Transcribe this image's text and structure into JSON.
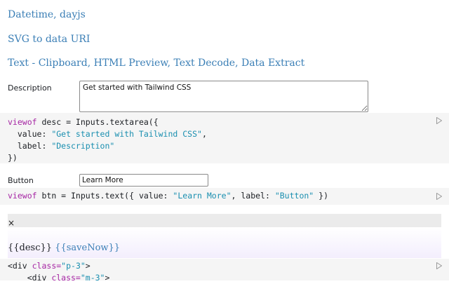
{
  "links": [
    {
      "label": "Datetime, dayjs"
    },
    {
      "label": "SVG to data URI"
    },
    {
      "label": "Text - Clipboard, HTML Preview, Text Decode, Data Extract"
    }
  ],
  "description": {
    "label": "Description",
    "value": "Get started with Tailwind CSS"
  },
  "button_field": {
    "label": "Button",
    "value": "Learn More"
  },
  "code1": {
    "l1_kw": "viewof",
    "l1_rest": " desc = Inputs.textarea({",
    "l2_key": "  value: ",
    "l2_val": "\"Get started with Tailwind CSS\"",
    "l2_end": ",",
    "l3_key": "  label: ",
    "l3_val": "\"Description\"",
    "l4": "})"
  },
  "code2": {
    "kw": "viewof",
    "p1": " btn = Inputs.text({ value: ",
    "v1": "\"Learn More\"",
    "p2": ", label: ",
    "v2": "\"Button\"",
    "p3": " })"
  },
  "preview": {
    "close": "×",
    "desc_tpl": "{{desc}}",
    "save_tpl": "{{saveNow}}"
  },
  "code3": {
    "l1_a": "<div ",
    "l1_b": "class=",
    "l1_c": "\"p-3\"",
    "l1_d": ">",
    "l2_a": "    <div ",
    "l2_b": "class=",
    "l2_c": "\"m-3\"",
    "l2_d": ">"
  },
  "icons": {
    "run": "play-icon"
  },
  "colors": {
    "link": "#3b7fb6",
    "string": "#1a8fb0",
    "keyword": "#a626a4",
    "code_bg": "#f5f5f5"
  }
}
